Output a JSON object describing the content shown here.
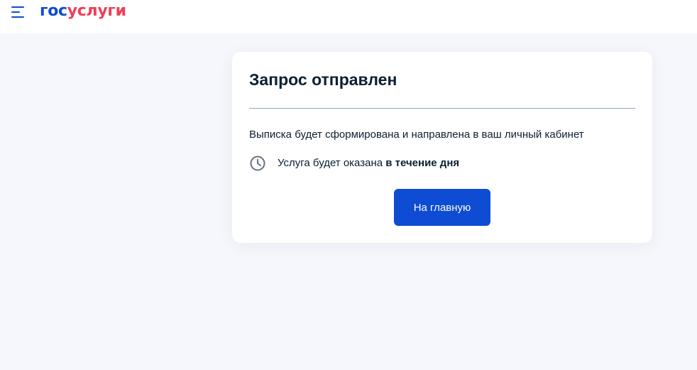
{
  "header": {
    "logo_part1": "гос",
    "logo_part2": "услуги",
    "menu_icon": "hamburger-menu-icon",
    "brand_blue": "#0d4cd3",
    "brand_red": "#ee3f58"
  },
  "card": {
    "title": "Запрос отправлен",
    "message": "Выписка будет сформирована и направлена в ваш личный кабинет",
    "info_icon": "clock-icon",
    "info_text": "Услуга будет оказана",
    "info_emphasis": "в течение дня",
    "button_label": "На главную"
  },
  "colors": {
    "page_background": "#f5f7fc",
    "card_background": "#ffffff",
    "text": "#0b1f33",
    "divider": "#8fa6c4",
    "button": "#0d4cd3",
    "button_text": "#ffffff"
  }
}
